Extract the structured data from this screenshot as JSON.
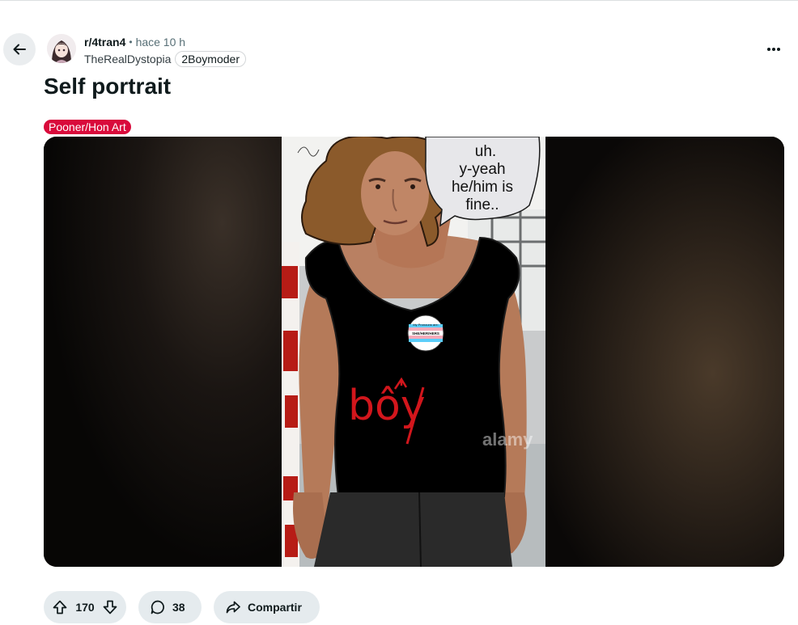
{
  "post": {
    "subreddit": "r/4tran4",
    "separator": "•",
    "time": "hace 10 h",
    "username": "TheRealDystopia",
    "user_flair": "2Boymoder",
    "title": "Self portrait",
    "post_flair": "Pooner/Hon Art"
  },
  "image": {
    "speech_bubble_lines": [
      "uh.",
      "y-yeah",
      "he/him is",
      "fine.."
    ],
    "shirt_text": "bôy",
    "pin_top": "My Pronouns are:",
    "pin_bottom": "SHE/HER/HERS",
    "watermark": "alamy"
  },
  "actions": {
    "vote_count": "170",
    "comment_count": "38",
    "share_label": "Compartir"
  },
  "colors": {
    "post_flair_bg": "#d90a3b",
    "pill_bg": "#e5ebee",
    "back_btn_bg": "#eaedef"
  }
}
